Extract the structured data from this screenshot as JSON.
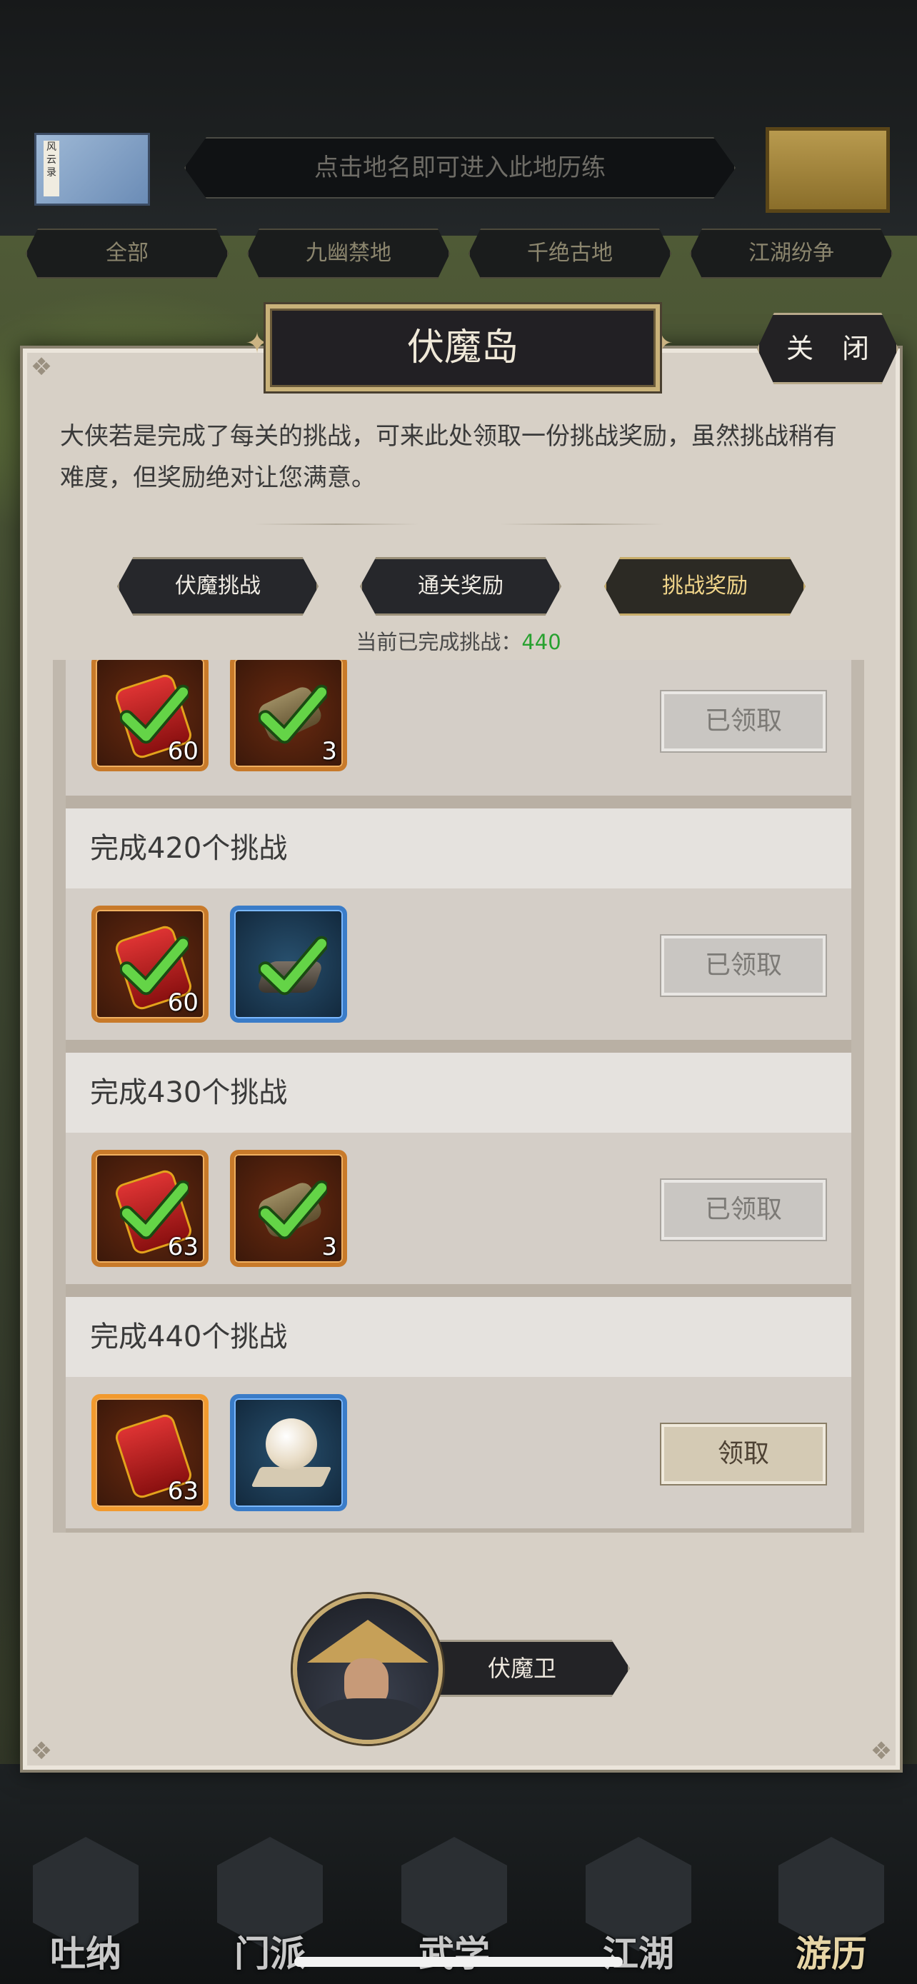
{
  "map_select": {
    "hint": "点击地名即可进入此地历练",
    "regions": [
      "全部",
      "九幽禁地",
      "千绝古地",
      "江湖纷争"
    ]
  },
  "dialog": {
    "title": "伏魔岛",
    "close_label": "关 闭",
    "description": "大侠若是完成了每关的挑战，可来此处领取一份挑战奖励，虽然挑战稍有难度，但奖励绝对让您满意。",
    "tabs": [
      {
        "label": "伏魔挑战",
        "active": false
      },
      {
        "label": "通关奖励",
        "active": false
      },
      {
        "label": "挑战奖励",
        "active": true
      }
    ],
    "progress_label": "当前已完成挑战：",
    "progress_value": "440",
    "rewards": [
      {
        "title": "",
        "items": [
          {
            "icon": "token-icon",
            "qty": "60",
            "claimed": true
          },
          {
            "icon": "scroll-icon",
            "qty": "3",
            "claimed": true
          }
        ],
        "button": "已领取",
        "claimed": true
      },
      {
        "title": "完成420个挑战",
        "items": [
          {
            "icon": "token-icon",
            "qty": "60",
            "claimed": true
          },
          {
            "icon": "book-icon",
            "qty": "",
            "claimed": true
          }
        ],
        "button": "已领取",
        "claimed": true
      },
      {
        "title": "完成430个挑战",
        "items": [
          {
            "icon": "token-icon",
            "qty": "63",
            "claimed": true
          },
          {
            "icon": "scroll-icon",
            "qty": "3",
            "claimed": true
          }
        ],
        "button": "已领取",
        "claimed": true
      },
      {
        "title": "完成440个挑战",
        "items": [
          {
            "icon": "token-icon",
            "qty": "63",
            "claimed": false
          },
          {
            "icon": "pearl-icon",
            "qty": "",
            "claimed": false
          }
        ],
        "button": "领取",
        "claimed": false
      }
    ],
    "npc_name": "伏魔卫"
  },
  "bottom_nav": [
    "吐纳",
    "门派",
    "武学",
    "江湖",
    "游历"
  ],
  "colors": {
    "progress_value": "#27a12f",
    "active_tab_text": "#f1d58a",
    "panel_bg": "#d7d0c6"
  }
}
